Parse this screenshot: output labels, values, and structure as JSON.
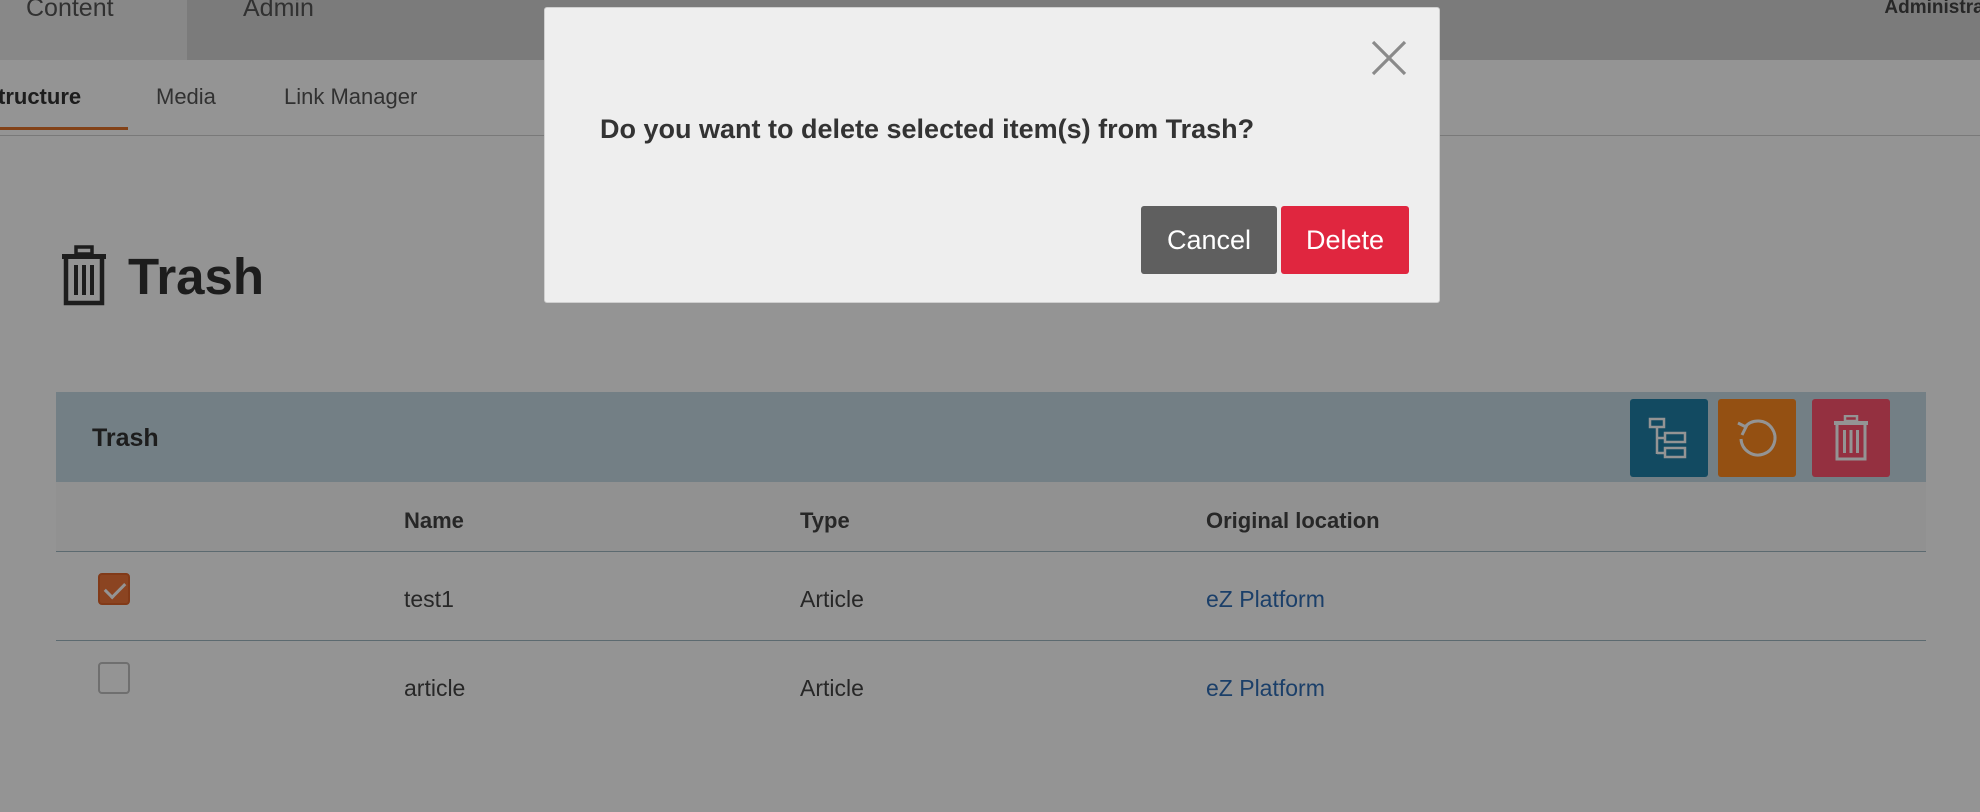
{
  "top_nav": {
    "tabs": [
      {
        "label": "Content",
        "active": true
      },
      {
        "label": "Admin",
        "active": false
      }
    ],
    "user": "Administrat"
  },
  "sub_nav": {
    "items": [
      {
        "label": "tructure",
        "active": true
      },
      {
        "label": "Media",
        "active": false
      },
      {
        "label": "Link Manager",
        "active": false
      }
    ]
  },
  "page": {
    "title": "Trash",
    "title_icon": "trash-icon"
  },
  "panel": {
    "title": "Trash",
    "actions": [
      {
        "name": "tree-icon",
        "color": "#1f80a8"
      },
      {
        "name": "restore-icon",
        "color": "#ff8a1f"
      },
      {
        "name": "trash-icon",
        "color": "#ff536e"
      }
    ],
    "columns": [
      "Name",
      "Type",
      "Original location"
    ],
    "rows": [
      {
        "checked": true,
        "name": "test1",
        "type": "Article",
        "location": "eZ Platform"
      },
      {
        "checked": false,
        "name": "article",
        "type": "Article",
        "location": "eZ Platform"
      }
    ]
  },
  "modal": {
    "message": "Do you want to delete selected item(s) from Trash?",
    "cancel_label": "Cancel",
    "delete_label": "Delete"
  },
  "colors": {
    "accent": "#e2732a",
    "delete": "#e0263f",
    "cancel": "#5f5f5f",
    "link": "#2f6db5"
  }
}
